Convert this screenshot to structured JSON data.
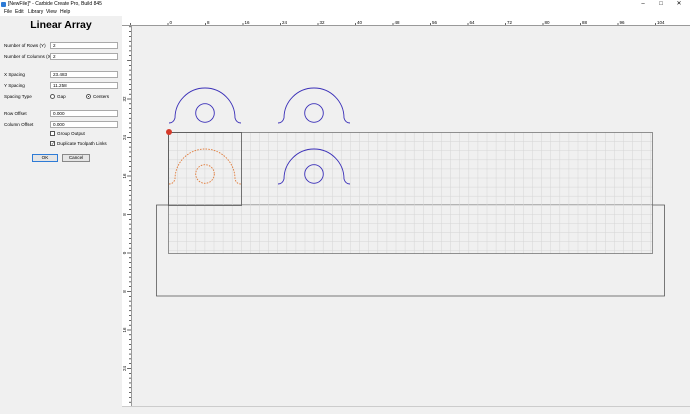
{
  "window": {
    "title": "[NewFile]* - Carbide Create Pro, Build 845",
    "controls": [
      "–",
      "□",
      "✕"
    ]
  },
  "menu": [
    "File",
    "Edit",
    "Library",
    "View",
    "Help"
  ],
  "panel": {
    "title": "Linear Array",
    "rows_label": "Number of Rows (Y)",
    "rows_value": "2",
    "cols_label": "Number of Columns (X)",
    "cols_value": "2",
    "xspacing_label": "X Spacing",
    "xspacing_value": "23.483",
    "yspacing_label": "Y Spacing",
    "yspacing_value": "11.258",
    "spacing_type_label": "Spacing Type",
    "spacing_options": [
      "Gap",
      "Centers"
    ],
    "spacing_selected": "Centers",
    "row_offset_label": "Row Offset",
    "row_offset_value": "0.000",
    "col_offset_label": "Column Offset",
    "col_offset_value": "0.000",
    "group_output_label": "Group Output",
    "group_output_checked": false,
    "dup_links_label": "Duplicate Toolpath Links",
    "dup_links_checked": true,
    "ok_label": "OK",
    "cancel_label": "Cancel"
  },
  "rulers": {
    "top_labels": [
      "0",
      "8",
      "16",
      "24",
      "32",
      "40",
      "48",
      "56",
      "64",
      "72",
      "80",
      "88",
      "96",
      "104"
    ],
    "left_labels": [
      "32",
      "24",
      "16",
      "8",
      "0",
      "8",
      "16",
      "24"
    ]
  },
  "colors": {
    "selected_shape": "#e07b3a",
    "copy_shape": "#3a2fb8",
    "grid": "#d6d6d6",
    "accent": "#2e7bd6"
  }
}
